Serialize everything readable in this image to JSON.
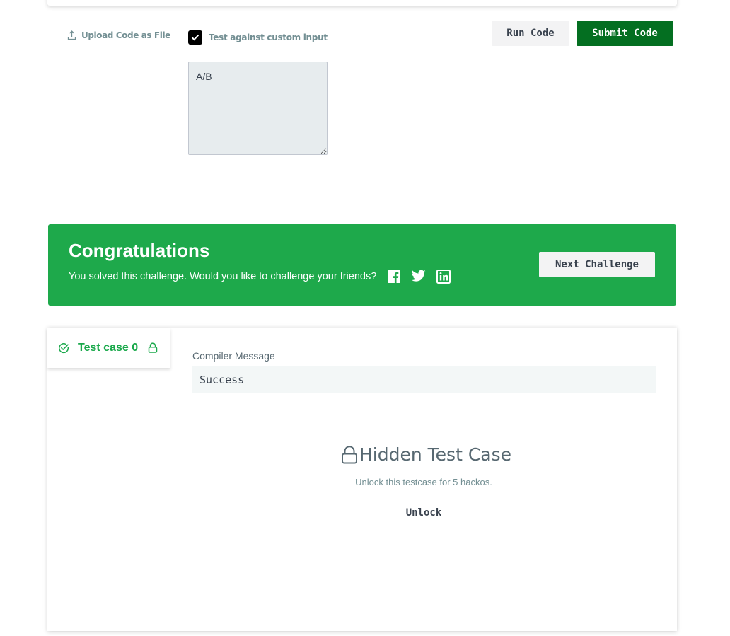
{
  "editor": {
    "upload_label": "Upload Code as File",
    "custom_input_label": "Test against custom input",
    "custom_input_checked": true,
    "custom_input_value": "A/B",
    "run_label": "Run Code",
    "submit_label": "Submit Code"
  },
  "congrats": {
    "title": "Congratulations",
    "subtitle": "You solved this challenge. Would you like to challenge your friends?",
    "next_label": "Next Challenge",
    "social_icons": [
      "facebook-icon",
      "twitter-icon",
      "linkedin-icon"
    ]
  },
  "results": {
    "testcase_label": "Test case 0",
    "compiler_label": "Compiler Message",
    "compiler_message": "Success",
    "hidden_title": "Hidden Test Case",
    "hidden_subtitle": "Unlock this testcase for 5 hackos.",
    "unlock_label": "Unlock"
  },
  "colors": {
    "success_green": "#1ea94b",
    "submit_green": "#046f21",
    "button_gray": "#f3f3f4",
    "text_dark": "#39424e",
    "text_muted": "#738f93"
  }
}
